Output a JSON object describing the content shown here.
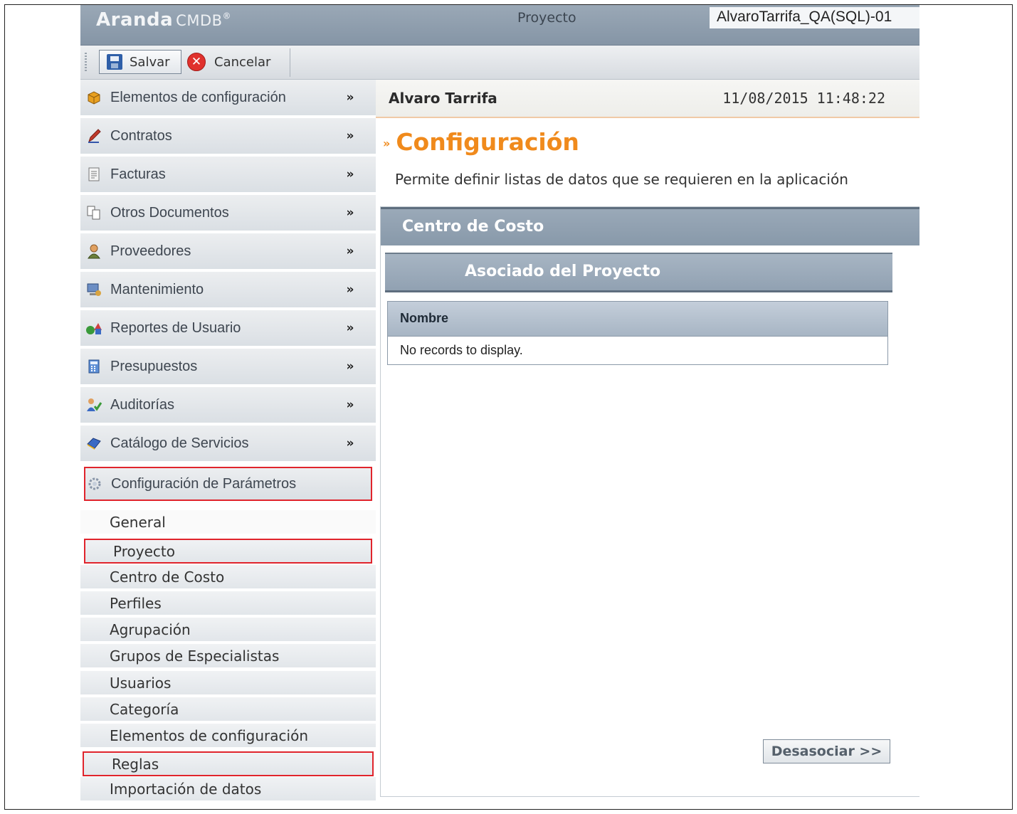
{
  "header": {
    "logo_brand": "Aranda",
    "logo_product": "CMDB",
    "logo_reg": "®",
    "section": "Proyecto",
    "connection": "AlvaroTarrifa_QA(SQL)-01"
  },
  "toolbar": {
    "save_label": "Salvar",
    "cancel_label": "Cancelar"
  },
  "sidebar": {
    "menu": [
      {
        "label": "Elementos de configuración",
        "icon": "box-icon"
      },
      {
        "label": "Contratos",
        "icon": "pencil-icon"
      },
      {
        "label": "Facturas",
        "icon": "invoice-icon"
      },
      {
        "label": "Otros Documentos",
        "icon": "documents-icon"
      },
      {
        "label": "Proveedores",
        "icon": "person-icon"
      },
      {
        "label": "Mantenimiento",
        "icon": "computer-icon"
      },
      {
        "label": "Reportes de Usuario",
        "icon": "reports-icon"
      },
      {
        "label": "Presupuestos",
        "icon": "calculator-icon"
      },
      {
        "label": "Auditorías",
        "icon": "audit-icon"
      },
      {
        "label": "Catálogo de Servicios",
        "icon": "catalog-icon"
      },
      {
        "label": "Configuración de Parámetros",
        "icon": "gear-icon"
      }
    ],
    "submenu": [
      "General",
      "Proyecto",
      "Centro de Costo",
      "Perfiles",
      "Agrupación",
      "Grupos de Especialistas",
      "Usuarios",
      "Categoría",
      "Elementos de configuración",
      "Reglas",
      "Importación de datos"
    ]
  },
  "main": {
    "user_name": "Alvaro Tarrifa",
    "datetime": "11/08/2015 11:48:22",
    "title": "Configuración",
    "description": "Permite definir listas de datos que se requieren en la aplicación",
    "panel_title": "Centro de Costo",
    "sub_panel_title": "Asociado del Proyecto",
    "grid_column": "Nombre",
    "grid_empty": "No records to display.",
    "disassociate_label": "Desasociar >>"
  },
  "colors": {
    "accent_orange": "#f08a1c",
    "header_blue_gray": "#8f9fb0",
    "highlight_red": "#e0242c"
  }
}
